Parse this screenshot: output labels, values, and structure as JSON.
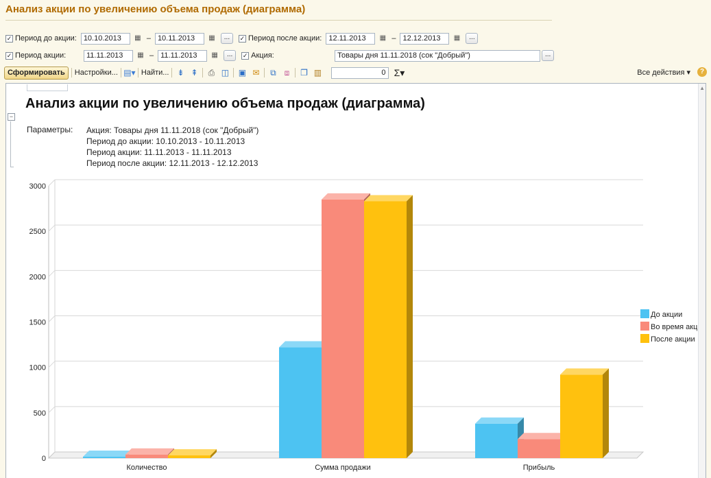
{
  "window_title": "Анализ акции по увеличению объема продаж (диаграмма)",
  "filters": {
    "row1": {
      "before_label": "Период до акции:",
      "before_from": "10.10.2013",
      "before_to": "10.11.2013",
      "after_label": "Период после акции:",
      "after_from": "12.11.2013",
      "after_to": "12.12.2013"
    },
    "row2": {
      "during_label": "Период акции:",
      "during_from": "11.11.2013",
      "during_to": "11.11.2013",
      "promo_label": "Акция:",
      "promo_value": "Товары дня 11.11.2018 (сок \"Добрый\")"
    },
    "dash": "–",
    "dots": "..."
  },
  "toolbar": {
    "generate_label": "Сформировать",
    "settings_label": "Настройки...",
    "find_label": "Найти...",
    "sum_value": "0",
    "all_actions_label": "Все действия",
    "help": "?"
  },
  "report": {
    "title": "Анализ акции по увеличению объема продаж (диаграмма)",
    "params_label": "Параметры:",
    "params": [
      "Акция: Товары дня 11.11.2018 (сок \"Добрый\")",
      "Период до акции: 10.10.2013 - 10.11.2013",
      "Период акции: 11.11.2013 - 11.11.2013",
      "Период после акции: 12.11.2013 - 12.12.2013"
    ]
  },
  "chart_data": {
    "type": "bar",
    "categories": [
      "Количество",
      "Сумма продажи",
      "Прибыль"
    ],
    "series": [
      {
        "name": "До акции",
        "values": [
          15,
          1220,
          380
        ],
        "color": "#4dc3f2"
      },
      {
        "name": "Во время акции",
        "values": [
          40,
          2850,
          210
        ],
        "color": "#f98a7a"
      },
      {
        "name": "После акции",
        "values": [
          30,
          2830,
          920
        ],
        "color": "#ffc10e"
      }
    ],
    "yticks": [
      "0",
      "500",
      "1000",
      "1500",
      "2000",
      "2500",
      "3000"
    ],
    "ylim": [
      0,
      3000
    ],
    "grid": true,
    "legend_position": "right"
  }
}
